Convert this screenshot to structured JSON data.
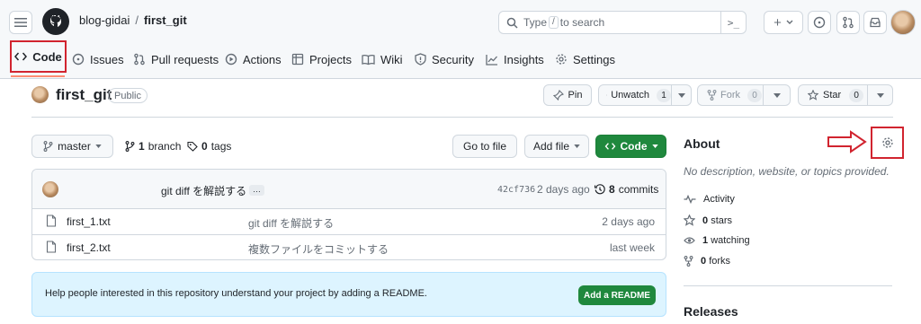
{
  "header": {
    "owner": "blog-gidai",
    "separator": "/",
    "repo": "first_git",
    "search": {
      "prefix": "Type",
      "key": "/",
      "suffix": "to search",
      "command_glyph": ">_"
    },
    "new_glyph": "+"
  },
  "nav": {
    "code": "Code",
    "issues": "Issues",
    "pull_requests": "Pull requests",
    "actions": "Actions",
    "projects": "Projects",
    "wiki": "Wiki",
    "security": "Security",
    "insights": "Insights",
    "settings": "Settings"
  },
  "repo_header": {
    "name": "first_git",
    "visibility": "Public",
    "pin": "Pin",
    "unwatch": "Unwatch",
    "watch_count": "1",
    "fork": "Fork",
    "fork_count": "0",
    "star": "Star",
    "star_count": "0"
  },
  "branch_bar": {
    "branch": "master",
    "branch_count": "1",
    "branch_word": "branch",
    "tag_count": "0",
    "tag_word": "tags",
    "go_to_file": "Go to file",
    "add_file": "Add file",
    "code": "Code"
  },
  "latest_commit": {
    "message": "git diff を解説する",
    "ellipsis": "…",
    "sha": "42cf736",
    "time": "2 days ago",
    "commit_count": "8",
    "commit_word": "commits"
  },
  "files": [
    {
      "name": "first_1.txt",
      "message": "git diff を解説する",
      "time": "2 days ago"
    },
    {
      "name": "first_2.txt",
      "message": "複数ファイルをコミットする",
      "time": "last week"
    }
  ],
  "readme": {
    "text": "Help people interested in this repository understand your project by adding a README.",
    "button": "Add a README"
  },
  "about": {
    "title": "About",
    "description": "No description, website, or topics provided.",
    "activity": "Activity",
    "stars_count": "0",
    "stars_word": "stars",
    "watching_count": "1",
    "watching_word": "watching",
    "forks_count": "0",
    "forks_word": "forks",
    "releases": "Releases"
  },
  "colors": {
    "accent_green": "#1f883d",
    "highlight_red": "#d1242f",
    "readme_bg": "#ddf4ff"
  }
}
